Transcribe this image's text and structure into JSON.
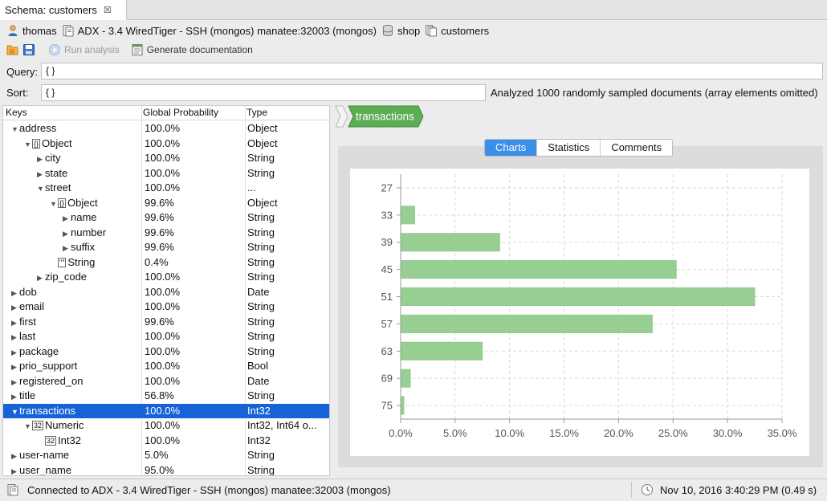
{
  "tab": {
    "label": "Schema: customers",
    "close_icon": "close-x-icon"
  },
  "breadcrumb": {
    "user": "thomas",
    "connection": "ADX - 3.4 WiredTiger - SSH (mongos) manatee:32003 (mongos)",
    "database": "shop",
    "collection": "customers"
  },
  "toolbar": {
    "run_analysis": "Run analysis",
    "generate_documentation": "Generate documentation"
  },
  "query": {
    "label": "Query:",
    "value": "{ }"
  },
  "sort": {
    "label": "Sort:",
    "value": "{ }"
  },
  "analyzed_note": "Analyzed 1000 randomly sampled documents (array elements omitted)",
  "table": {
    "headers": [
      "Keys",
      "Global Probability",
      "Type"
    ],
    "rows": [
      {
        "level": 1,
        "arrow": "down",
        "icon": "",
        "key": "address",
        "prob": "100.0%",
        "type": "Object"
      },
      {
        "level": 2,
        "arrow": "down",
        "icon": "{}",
        "key": "Object",
        "prob": "100.0%",
        "type": "Object"
      },
      {
        "level": 3,
        "arrow": "right",
        "icon": "",
        "key": "city",
        "prob": "100.0%",
        "type": "String"
      },
      {
        "level": 3,
        "arrow": "right",
        "icon": "",
        "key": "state",
        "prob": "100.0%",
        "type": "String"
      },
      {
        "level": 3,
        "arrow": "down",
        "icon": "",
        "key": "street",
        "prob": "100.0%",
        "type": "..."
      },
      {
        "level": 4,
        "arrow": "down",
        "icon": "{}",
        "key": "Object",
        "prob": "99.6%",
        "type": "Object"
      },
      {
        "level": 5,
        "arrow": "right",
        "icon": "",
        "key": "name",
        "prob": "99.6%",
        "type": "String"
      },
      {
        "level": 5,
        "arrow": "right",
        "icon": "",
        "key": "number",
        "prob": "99.6%",
        "type": "String"
      },
      {
        "level": 5,
        "arrow": "right",
        "icon": "",
        "key": "suffix",
        "prob": "99.6%",
        "type": "String"
      },
      {
        "level": 4,
        "arrow": "",
        "icon": "\"\"",
        "key": "String",
        "prob": "0.4%",
        "type": "String"
      },
      {
        "level": 3,
        "arrow": "right",
        "icon": "",
        "key": "zip_code",
        "prob": "100.0%",
        "type": "String"
      },
      {
        "level": 1,
        "arrow": "right",
        "icon": "",
        "key": "dob",
        "prob": "100.0%",
        "type": "Date"
      },
      {
        "level": 1,
        "arrow": "right",
        "icon": "",
        "key": "email",
        "prob": "100.0%",
        "type": "String"
      },
      {
        "level": 1,
        "arrow": "right",
        "icon": "",
        "key": "first",
        "prob": "99.6%",
        "type": "String"
      },
      {
        "level": 1,
        "arrow": "right",
        "icon": "",
        "key": "last",
        "prob": "100.0%",
        "type": "String"
      },
      {
        "level": 1,
        "arrow": "right",
        "icon": "",
        "key": "package",
        "prob": "100.0%",
        "type": "String"
      },
      {
        "level": 1,
        "arrow": "right",
        "icon": "",
        "key": "prio_support",
        "prob": "100.0%",
        "type": "Bool"
      },
      {
        "level": 1,
        "arrow": "right",
        "icon": "",
        "key": "registered_on",
        "prob": "100.0%",
        "type": "Date"
      },
      {
        "level": 1,
        "arrow": "right",
        "icon": "",
        "key": "title",
        "prob": "56.8%",
        "type": "String"
      },
      {
        "level": 1,
        "arrow": "down",
        "icon": "",
        "key": "transactions",
        "prob": "100.0%",
        "type": "Int32",
        "selected": true
      },
      {
        "level": 2,
        "arrow": "down",
        "icon": "32",
        "key": "Numeric",
        "prob": "100.0%",
        "type": "Int32, Int64 o..."
      },
      {
        "level": 3,
        "arrow": "",
        "icon": "32",
        "key": "Int32",
        "prob": "100.0%",
        "type": "Int32"
      },
      {
        "level": 1,
        "arrow": "right",
        "icon": "",
        "key": "user-name",
        "prob": "5.0%",
        "type": "String"
      },
      {
        "level": 1,
        "arrow": "right",
        "icon": "",
        "key": "user_name",
        "prob": "95.0%",
        "type": "String"
      }
    ]
  },
  "field_path": [
    "transactions"
  ],
  "view_tabs": [
    "Charts",
    "Statistics",
    "Comments"
  ],
  "active_view_tab": "Charts",
  "chart_data": {
    "type": "bar",
    "orientation": "horizontal",
    "categories": [
      "27",
      "33",
      "39",
      "45",
      "51",
      "57",
      "63",
      "69",
      "75"
    ],
    "values": [
      0.0,
      1.3,
      9.1,
      25.3,
      32.5,
      23.1,
      7.5,
      0.9,
      0.3
    ],
    "xticks": [
      "0.0%",
      "5.0%",
      "10.0%",
      "15.0%",
      "20.0%",
      "25.0%",
      "30.0%",
      "35.0%"
    ],
    "xlim": [
      0,
      35
    ],
    "grid": true,
    "bar_color": "#97cf92",
    "bar_edge": "#88c382"
  },
  "status": {
    "connection": "Connected to ADX - 3.4 WiredTiger - SSH (mongos) manatee:32003 (mongos)",
    "timestamp": "Nov 10, 2016 3:40:29 PM (0.49 s)"
  },
  "colors": {
    "selection": "#1663d8",
    "active_tab": "#3c8fe6",
    "path_tag": "#5cad54"
  }
}
